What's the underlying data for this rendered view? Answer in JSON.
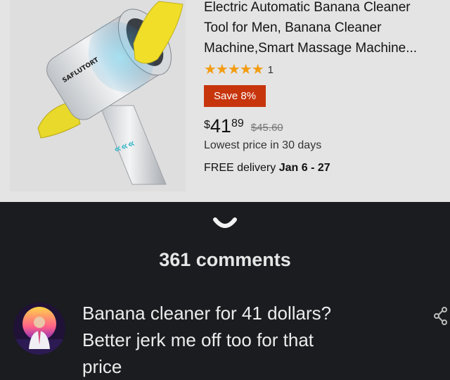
{
  "product": {
    "title_lines": [
      "Electric Automatic Banana Cleaner",
      "Tool for Men, Banana Cleaner",
      "Machine,Smart Massage Machine..."
    ],
    "stars": "★★★★★",
    "rating_value": 5,
    "rating_count": "1",
    "save_badge": "Save 8%",
    "price_currency": "$",
    "price_whole": "41",
    "price_fraction": "89",
    "price_was": "$45.60",
    "lowest_price": "Lowest price in 30 days",
    "delivery_label": "FREE delivery",
    "delivery_dates": "Jan 6 - 27",
    "device_brand": "SAFLUTORT"
  },
  "comments": {
    "count_label": "361 comments",
    "collapse_icon": "chevron-down-icon",
    "items": [
      {
        "avatar_icon": "user-avatar",
        "lines": [
          "Banana cleaner for 41 dollars?",
          "Better jerk me off too for that",
          "price"
        ],
        "share_icon": "share-icon"
      }
    ]
  },
  "colors": {
    "page_bg": "#1b1c20",
    "card_bg": "#e4e4e4",
    "save_badge": "#c7350d",
    "star": "#f39c12",
    "text_light": "#e6e6e6"
  }
}
